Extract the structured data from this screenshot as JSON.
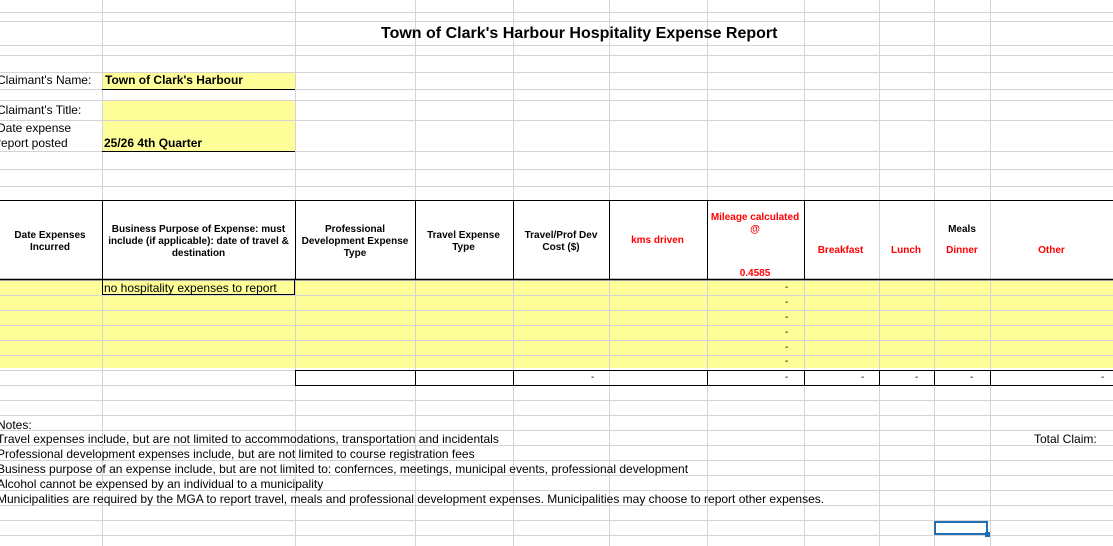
{
  "report": {
    "title": "Town of Clark's Harbour Hospitality Expense Report"
  },
  "claimant": {
    "name_label": "Claimant's Name:",
    "name_value": "Town of Clark's Harbour",
    "title_label": "Claimant's Title:",
    "title_value": "",
    "date_label_line1": "Date expense",
    "date_label_line2": "report posted",
    "date_value": "25/26 4th Quarter"
  },
  "table": {
    "headers": {
      "date": "Date Expenses Incurred",
      "purpose": "Business Purpose of Expense: must include (if applicable): date of travel & destination",
      "prof_dev": "Professional Development Expense Type",
      "travel_type": "Travel Expense Type",
      "travel_cost": "Travel/Prof Dev Cost ($)",
      "kms": "kms driven",
      "mileage": "Mileage calculated @",
      "mileage_rate": "0.4585",
      "meals": "Meals",
      "breakfast": "Breakfast",
      "lunch": "Lunch",
      "dinner": "Dinner",
      "other": "Other"
    },
    "first_row_purpose": "no hospitality expenses to report",
    "dash": "-",
    "mileage_dashes": [
      "-",
      "-",
      "-",
      "-",
      "-",
      "-"
    ],
    "total_dashes": {
      "travel_cost": "-",
      "mileage": "-",
      "breakfast": "-",
      "lunch": "-",
      "dinner": "-",
      "other": "-"
    }
  },
  "notes": {
    "heading": "Notes:",
    "lines": [
      "Travel expenses include, but are not limited to accommodations, transportation and incidentals",
      "Professional development expenses include, but are not limited to course registration fees",
      "Business purpose of an expense include, but are not limited to: confernces, meetings, municipal events, professional development",
      "Alcohol cannot be expensed by an individual to a municipality",
      "Municipalities are required by the MGA to report travel, meals and professional development expenses. Municipalities may choose to report other expenses."
    ]
  },
  "total_claim_label": "Total Claim:",
  "colors": {
    "gridline": "#d4d4d4",
    "input_fill": "#ffff99",
    "header_red": "#ff0000",
    "selection": "#1f6fb5"
  }
}
